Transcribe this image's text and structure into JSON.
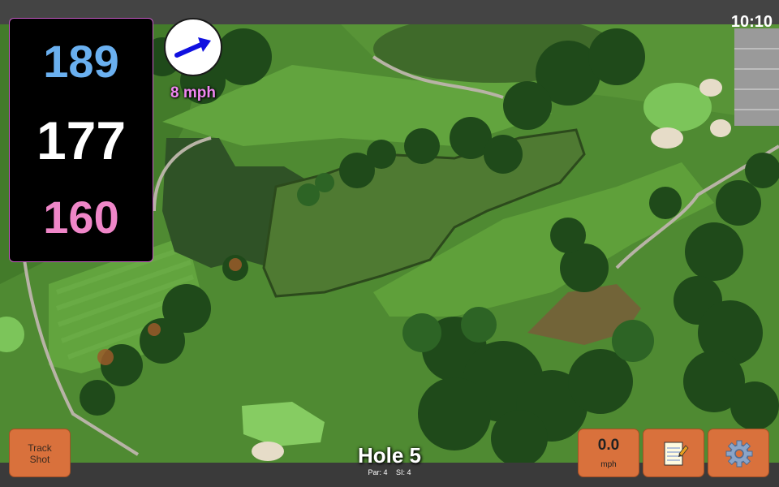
{
  "clock": "10:10",
  "distances": {
    "back": "189",
    "middle": "177",
    "front": "160"
  },
  "wind": {
    "speed_label": "8 mph",
    "icon": "wind-direction-arrow-icon"
  },
  "buttons": {
    "track_shot_line1": "Track",
    "track_shot_line2": "Shot",
    "speed_value": "0.0",
    "speed_unit": "mph",
    "notes_icon": "notepad-icon",
    "settings_icon": "gear-icon"
  },
  "hole": {
    "title": "Hole 5",
    "par": "Par: 4",
    "si": "SI: 4"
  },
  "colors": {
    "back": "#6ab0f0",
    "middle": "#ffffff",
    "front": "#ef86c8",
    "button": "#d9713c",
    "panel_border": "#c85ac8",
    "wind_text": "#ef86ef"
  }
}
